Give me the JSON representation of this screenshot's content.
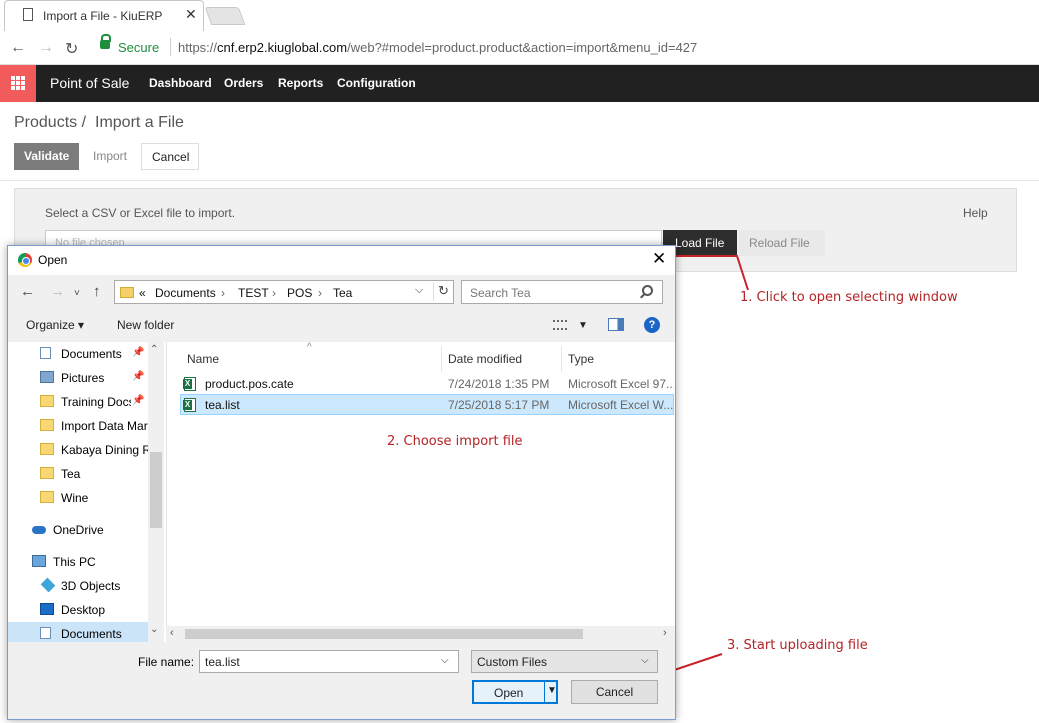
{
  "browser": {
    "tab_title": "Import a File - KiuERP",
    "secure_label": "Secure",
    "url_prefix": "https://",
    "url_host": "cnf.erp2.kiuglobal.com",
    "url_path": "/web?#model=product.product&action=import&menu_id=427"
  },
  "app": {
    "brand": "Point of Sale",
    "menu": [
      "Dashboard",
      "Orders",
      "Reports",
      "Configuration"
    ],
    "accent_color": "#f15b5b"
  },
  "page": {
    "breadcrumb_parent": "Products /",
    "breadcrumb_current": "Import a File",
    "validate_label": "Validate",
    "import_label": "Import",
    "cancel_label": "Cancel"
  },
  "import_panel": {
    "hint": "Select a CSV or Excel file to import.",
    "help": "Help",
    "file_placeholder": "No file chosen",
    "load_label": "Load File",
    "reload_label": "Reload File"
  },
  "annotations": {
    "step1": "1. Click to open selecting window",
    "step2": "2. Choose import file",
    "step3": "3. Start uploading file",
    "color": "#c8232a"
  },
  "dialog": {
    "title": "Open",
    "path_prefix": "«",
    "path": [
      "Documents",
      "TEST",
      "POS",
      "Tea"
    ],
    "search_placeholder": "Search Tea",
    "organize": "Organize ▾",
    "new_folder": "New folder",
    "help_glyph": "?",
    "nav_items": [
      {
        "label": "Documents",
        "icon": "document-icon",
        "pinned": true
      },
      {
        "label": "Pictures",
        "icon": "pictures-icon",
        "pinned": true
      },
      {
        "label": "Training Docs",
        "icon": "folder-icon",
        "pinned": true
      },
      {
        "label": "Import Data Mar",
        "icon": "folder-icon",
        "pinned": false
      },
      {
        "label": "Kabaya Dining R",
        "icon": "folder-icon",
        "pinned": false
      },
      {
        "label": "Tea",
        "icon": "folder-icon",
        "pinned": false
      },
      {
        "label": "Wine",
        "icon": "folder-icon",
        "pinned": false
      },
      {
        "label": "OneDrive",
        "icon": "cloud-icon",
        "pinned": false
      },
      {
        "label": "This PC",
        "icon": "pc-icon",
        "pinned": false
      },
      {
        "label": "3D Objects",
        "icon": "3d-objects-icon",
        "pinned": false
      },
      {
        "label": "Desktop",
        "icon": "desktop-icon",
        "pinned": false
      },
      {
        "label": "Documents",
        "icon": "document-icon",
        "pinned": false
      }
    ],
    "columns": [
      "Name",
      "Date modified",
      "Type"
    ],
    "files": [
      {
        "name": "product.pos.cate",
        "date": "7/24/2018 1:35 PM",
        "type": "Microsoft Excel 97...",
        "selected": false
      },
      {
        "name": "tea.list",
        "date": "7/25/2018 5:17 PM",
        "type": "Microsoft Excel W...",
        "selected": true
      }
    ],
    "file_name_label": "File name:",
    "file_name_value": "tea.list",
    "file_type_value": "Custom Files",
    "open_label": "Open",
    "cancel_label": "Cancel"
  }
}
